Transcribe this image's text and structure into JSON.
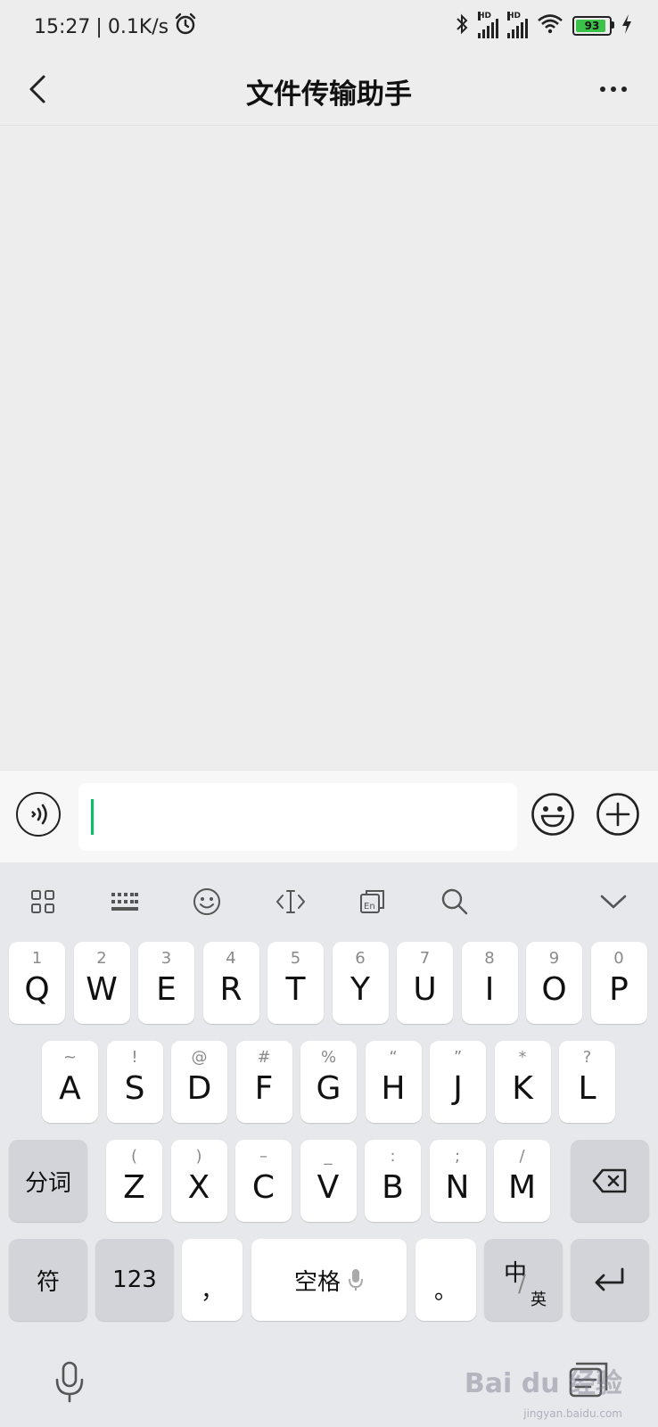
{
  "status": {
    "time": "15:27",
    "speed": "0.1K/s",
    "separator": "|",
    "battery": "93",
    "signal_label": "HD"
  },
  "header": {
    "title": "文件传输助手"
  },
  "input": {
    "value": ""
  },
  "keyboard": {
    "row1": [
      {
        "sub": "1",
        "main": "Q"
      },
      {
        "sub": "2",
        "main": "W"
      },
      {
        "sub": "3",
        "main": "E"
      },
      {
        "sub": "4",
        "main": "R"
      },
      {
        "sub": "5",
        "main": "T"
      },
      {
        "sub": "6",
        "main": "Y"
      },
      {
        "sub": "7",
        "main": "U"
      },
      {
        "sub": "8",
        "main": "I"
      },
      {
        "sub": "9",
        "main": "O"
      },
      {
        "sub": "0",
        "main": "P"
      }
    ],
    "row2": [
      {
        "sub": "~",
        "main": "A"
      },
      {
        "sub": "!",
        "main": "S"
      },
      {
        "sub": "@",
        "main": "D"
      },
      {
        "sub": "#",
        "main": "F"
      },
      {
        "sub": "%",
        "main": "G"
      },
      {
        "sub": "“",
        "main": "H"
      },
      {
        "sub": "”",
        "main": "J"
      },
      {
        "sub": "*",
        "main": "K"
      },
      {
        "sub": "?",
        "main": "L"
      }
    ],
    "row3_left": "分词",
    "row3": [
      {
        "sub": "(",
        "main": "Z"
      },
      {
        "sub": ")",
        "main": "X"
      },
      {
        "sub": "–",
        "main": "C"
      },
      {
        "sub": "_",
        "main": "V"
      },
      {
        "sub": ":",
        "main": "B"
      },
      {
        "sub": ";",
        "main": "N"
      },
      {
        "sub": "/",
        "main": "M"
      }
    ],
    "symbols_label": "符",
    "numbers_label": "123",
    "comma_label": "，",
    "space_label": "空格",
    "period_label": "。",
    "lang_main": "中",
    "lang_sub": "英"
  },
  "watermark": {
    "text": "Bai du 经验",
    "sub": "jingyan.baidu.com"
  }
}
